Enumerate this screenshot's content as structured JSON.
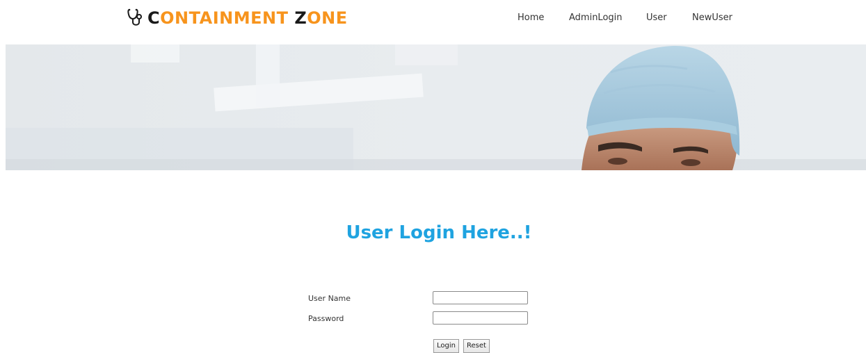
{
  "brand": {
    "name_part1_dark": "C",
    "name_part1_orange": "ONTAINMENT ",
    "name_part2_dark": "Z",
    "name_part2_orange": "ONE",
    "icon": "stethoscope-icon",
    "accent_color": "#f7941d"
  },
  "nav": {
    "items": [
      {
        "label": "Home"
      },
      {
        "label": "AdminLogin"
      },
      {
        "label": "User"
      },
      {
        "label": "NewUser"
      }
    ]
  },
  "banner": {
    "image": "surgeon-banner-image"
  },
  "login": {
    "title": "User Login Here..!",
    "title_color": "#1fa3e0",
    "username_label": "User Name",
    "username_value": "",
    "password_label": "Password",
    "password_value": "",
    "login_button": "Login",
    "reset_button": "Reset"
  }
}
